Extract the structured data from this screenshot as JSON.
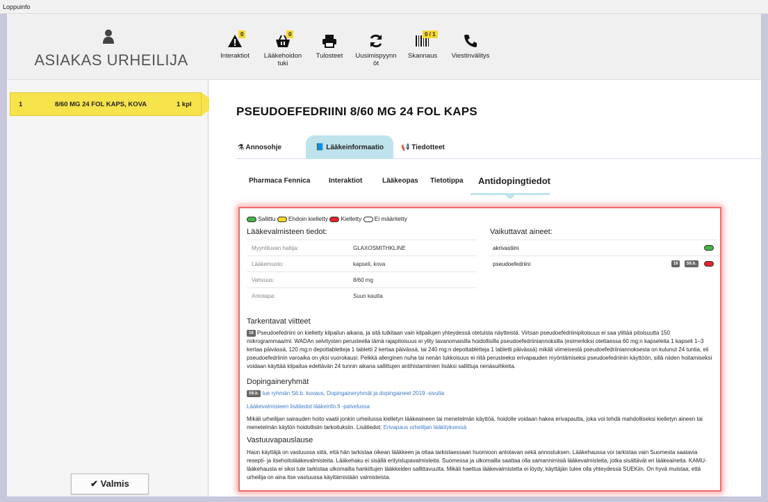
{
  "window": {
    "title": "Loppuinfo"
  },
  "customer": {
    "name": "ASIAKAS URHEILIJA"
  },
  "toolbar": [
    {
      "id": "interaktiot",
      "label": "Interaktiot",
      "badge": "0"
    },
    {
      "id": "laakehoidon",
      "label": "Lääkehoidon tuki",
      "badge": "0"
    },
    {
      "id": "tulosteet",
      "label": "Tulosteet",
      "badge": ""
    },
    {
      "id": "uusimis",
      "label": "Uusimispyynnöt",
      "badge": ""
    },
    {
      "id": "skannaus",
      "label": "Skannaus",
      "badge": "0 / 1"
    },
    {
      "id": "viesti",
      "label": "Viestinvälitys",
      "badge": ""
    }
  ],
  "order": {
    "index": "1",
    "product": "8/60 MG 24 FOL KAPS, KOVA",
    "qty": "1 kpl"
  },
  "done_button": "Valmis",
  "product_title": "PSEUDOEFEDRIINI 8/60 MG 24 FOL KAPS",
  "tabs": [
    "Annosohje",
    "Lääkeinformaatio",
    "Tiedotteet"
  ],
  "subtabs": [
    "Pharmaca Fennica",
    "Interaktiot",
    "Lääkeopas",
    "Tietotippa",
    "Antidopingtiedot"
  ],
  "legend": [
    "Sallittu",
    "Ehdoin kielletty",
    "Kielletty",
    "Ei määritetty"
  ],
  "product_info": {
    "heading": "Lääkevalmisteen tiedot:",
    "rows": [
      {
        "k": "Myyntiluvan haltija:",
        "v": "GLAXOSMITHKLINE"
      },
      {
        "k": "Lääkemuoto:",
        "v": "kapseli, kova"
      },
      {
        "k": "Vahvuus:",
        "v": "8/60 mg"
      },
      {
        "k": "Antotapa:",
        "v": "Suun kautta"
      }
    ]
  },
  "ingredients": {
    "heading": "Vaikuttavat aineet:",
    "items": [
      {
        "name": "akrivastiini",
        "tags": [],
        "status": "green"
      },
      {
        "name": "pseudoefedriini",
        "tags": [
          "18",
          "S6.b."
        ],
        "status": "red"
      }
    ]
  },
  "refs": {
    "heading": "Tarkentavat viitteet",
    "tag": "18",
    "text": "Pseudoefedriini on kielletty kilpailun aikana, ja sitä tutkitaan vain kilpailujen yhteydessä otetuista näytteistä. Virtsan pseudoefedriinipitoisuus ei saa ylittää pitoisuutta 150 mikrogrammaa/ml. WADAn selvitysten perusteella tämä rajapitoisuus ei ylity tavanomaisilla hoidollisilla pseudoefedriiniannoksilla (esimerkiksi otettaessa 60 mg:n kapseleita 1 kapseli 1–3 kertaa päivässä, 120 mg:n depottabletteja 1 tabletti 2 kertaa päivässä, tai 240 mg:n depottabletteja 1 tabletti päivässä) mikäli viimeisestä pseudoefedriiniannoksesta on kulunut 24 tuntia, eli pseudoefedriinin varoaika on yksi vuorokausi. Pelkkä allerginen nuha tai nenän tukkoisuus ei riitä perusteeksi erivapauden myöntämiseksi pseudoefedriinin käyttöön, sillä niiden hoitamiseksi voidaan käyttää kilpailua edeltävän 24 tunnin aikana sallittujen antihistamiinien lisäksi sallittuja nenäsuihkeita."
  },
  "doping": {
    "heading": "Dopingaineryhmät",
    "tag": "S6.b.",
    "link1": "lue ryhmän S6.b. kuvaus, Dopingaineryhmät ja dopingaineet 2019 -sivulta",
    "link2": "Lääkevalmisteen lisätiedot lääkeinfo.fi -palvelussa",
    "text": "Mikäli urheilijan sairauden hoito vaatii jonkin urheilussa kielletyn lääkeaineen tai menetelmän käyttöä, hoidolle voidaan hakea erivapautta, joka voi tehdä mahdolliseksi kielletyn aineen tai menetelmän käytön hoidollisiin tarkoituksiin. Lisätiedot:",
    "link3": "Erivapaus urheilijan lääkityksessä"
  },
  "disclaimer": {
    "heading": "Vastuuvapauslause",
    "text": "Haun käyttäjä on vastuussa siitä, että hän tarkistaa oikean lääkkeen ja ottaa tarkistaessaan huomioon antotavan sekä annostuksen. Lääkehaussa voi tarkistaa vain Suomesta saatavia resepti- ja itsehoitolääkevalmisteita. Lääkehaku ei sisällä erityislupavalmisteita. Suomessa ja ulkomailla saattaa olla samannimisiä lääkevalmisteita, jotka sisältävät eri lääkeaineita. KAMU-lääkehausta ei siksi tule tarkistaa ulkomailta hankittujen lääkkeiden sallittavuutta. Mikäli haettua lääkevalmistetta ei löydy, käyttäjän tulee olla yhteydessä SUEKiin. On hyvä muistaa, että urheilija on aina itse vastuussa käyttämistään valmisteista."
  },
  "colors": {
    "accent_yellow": "#f7e34b",
    "tab_active": "#bfe3ec",
    "alert_border": "#f06b6b"
  }
}
